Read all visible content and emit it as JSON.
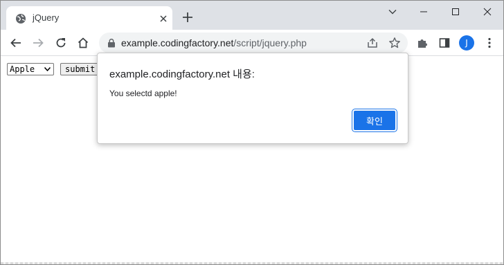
{
  "tab": {
    "title": "jQuery"
  },
  "address": {
    "host": "example.codingfactory.net",
    "path": "/script/jquery.php"
  },
  "profile": {
    "initial": "J"
  },
  "page": {
    "select_value": "Apple",
    "submit_label": "submit"
  },
  "dialog": {
    "title": "example.codingfactory.net 내용:",
    "message": "You selectd apple!",
    "ok_label": "확인"
  },
  "colors": {
    "accent": "#1a73e8",
    "tabstrip": "#dee1e6",
    "omnibox": "#f1f3f4"
  },
  "icons": [
    "globe-icon",
    "close-icon",
    "plus-icon",
    "chevron-down-icon",
    "minimize-icon",
    "maximize-icon",
    "back-icon",
    "forward-icon",
    "reload-icon",
    "home-icon",
    "lock-icon",
    "share-icon",
    "star-icon",
    "extensions-icon",
    "side-panel-icon",
    "menu-icon"
  ]
}
